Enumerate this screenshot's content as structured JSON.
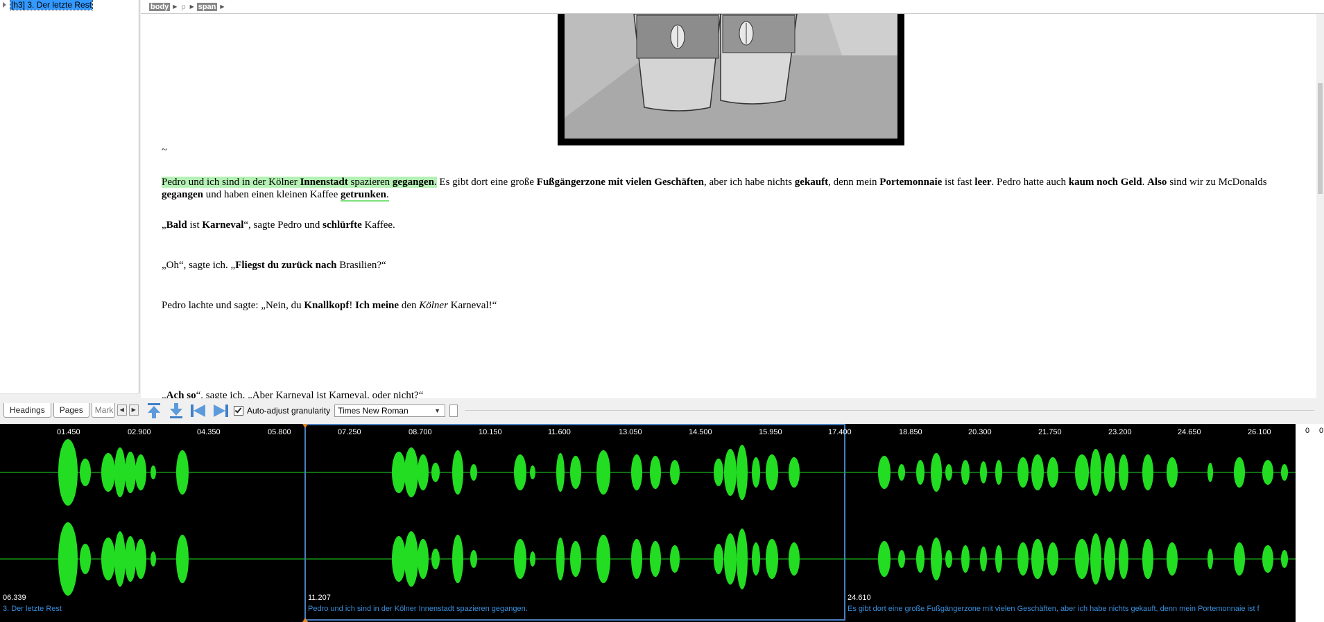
{
  "nav": {
    "tree_item": "[h3] 3. Der letzte Rest",
    "tabs": [
      "Headings",
      "Pages",
      "Mark"
    ]
  },
  "breadcrumb": [
    "body",
    "p",
    "span"
  ],
  "document": {
    "tilde": "~",
    "p1": {
      "hl_a": "Pedro und ich sind in der Kölner ",
      "hl_b": "Innenstadt",
      "hl_c": " spazieren ",
      "hl_d": "gegangen",
      "hl_e": ".",
      "a": " Es gibt dort eine große ",
      "b": "Fußgängerzone mit vielen Geschäften",
      "c": ", aber ich habe nichts ",
      "d": "gekauft",
      "e": ", denn mein ",
      "f": "Portemonnaie",
      "g": " ist fast ",
      "h": "leer",
      "i": ". Pedro hatte auch ",
      "j": "kaum noch Geld",
      "k": ". ",
      "l": "Also",
      "m": " sind wir zu McDonalds ",
      "n": "gegangen",
      "o": " und haben einen kleinen Kaffee ",
      "p": "getrunken",
      "q": "."
    },
    "p2": {
      "a": "„",
      "b": "Bald",
      "c": " ist ",
      "d": "Karneval",
      "e": "“, sagte Pedro und ",
      "f": "schlürfte",
      "g": " Kaffee."
    },
    "p3": {
      "a": "„Oh“, sagte ich. „",
      "b": "Fliegst du zurück nach",
      "c": " Brasilien?“"
    },
    "p4": {
      "a": "Pedro lachte und sagte: „Nein, du ",
      "b": "Knallkopf",
      "c": "! ",
      "d": "Ich meine",
      "e": " den ",
      "f": "Kölner",
      "g": " Karneval!“"
    },
    "p5": {
      "a": "„",
      "b": "Ach so",
      "c": "“, sagte ich. „Aber Karneval ist Karneval, oder nicht?“"
    }
  },
  "toolbar": {
    "checkbox_label": "Auto-adjust granularity",
    "checkbox_checked": true,
    "font": "Times New Roman"
  },
  "waveform": {
    "time_ticks": [
      "01.450",
      "02.900",
      "04.350",
      "05.800",
      "07.250",
      "08.700",
      "10.150",
      "11.600",
      "13.050",
      "14.500",
      "15.950",
      "17.400",
      "18.850",
      "20.300",
      "21.750",
      "23.200",
      "24.650",
      "26.100"
    ],
    "segments": [
      {
        "time": "06.339",
        "text": "3. Der letzte Rest"
      },
      {
        "time": "11.207",
        "text": "Pedro und ich sind in der Kölner Innenstadt spazieren gegangen."
      },
      {
        "time": "24.610",
        "text": "Es gibt dort eine große Fußgängerzone mit vielen Geschäften, aber ich habe nichts gekauft, denn mein Portemonnaie ist f"
      }
    ],
    "right_panel": [
      "0",
      "0"
    ],
    "wave_color": "#22dd22",
    "selection_color": "#4a7fc0"
  }
}
